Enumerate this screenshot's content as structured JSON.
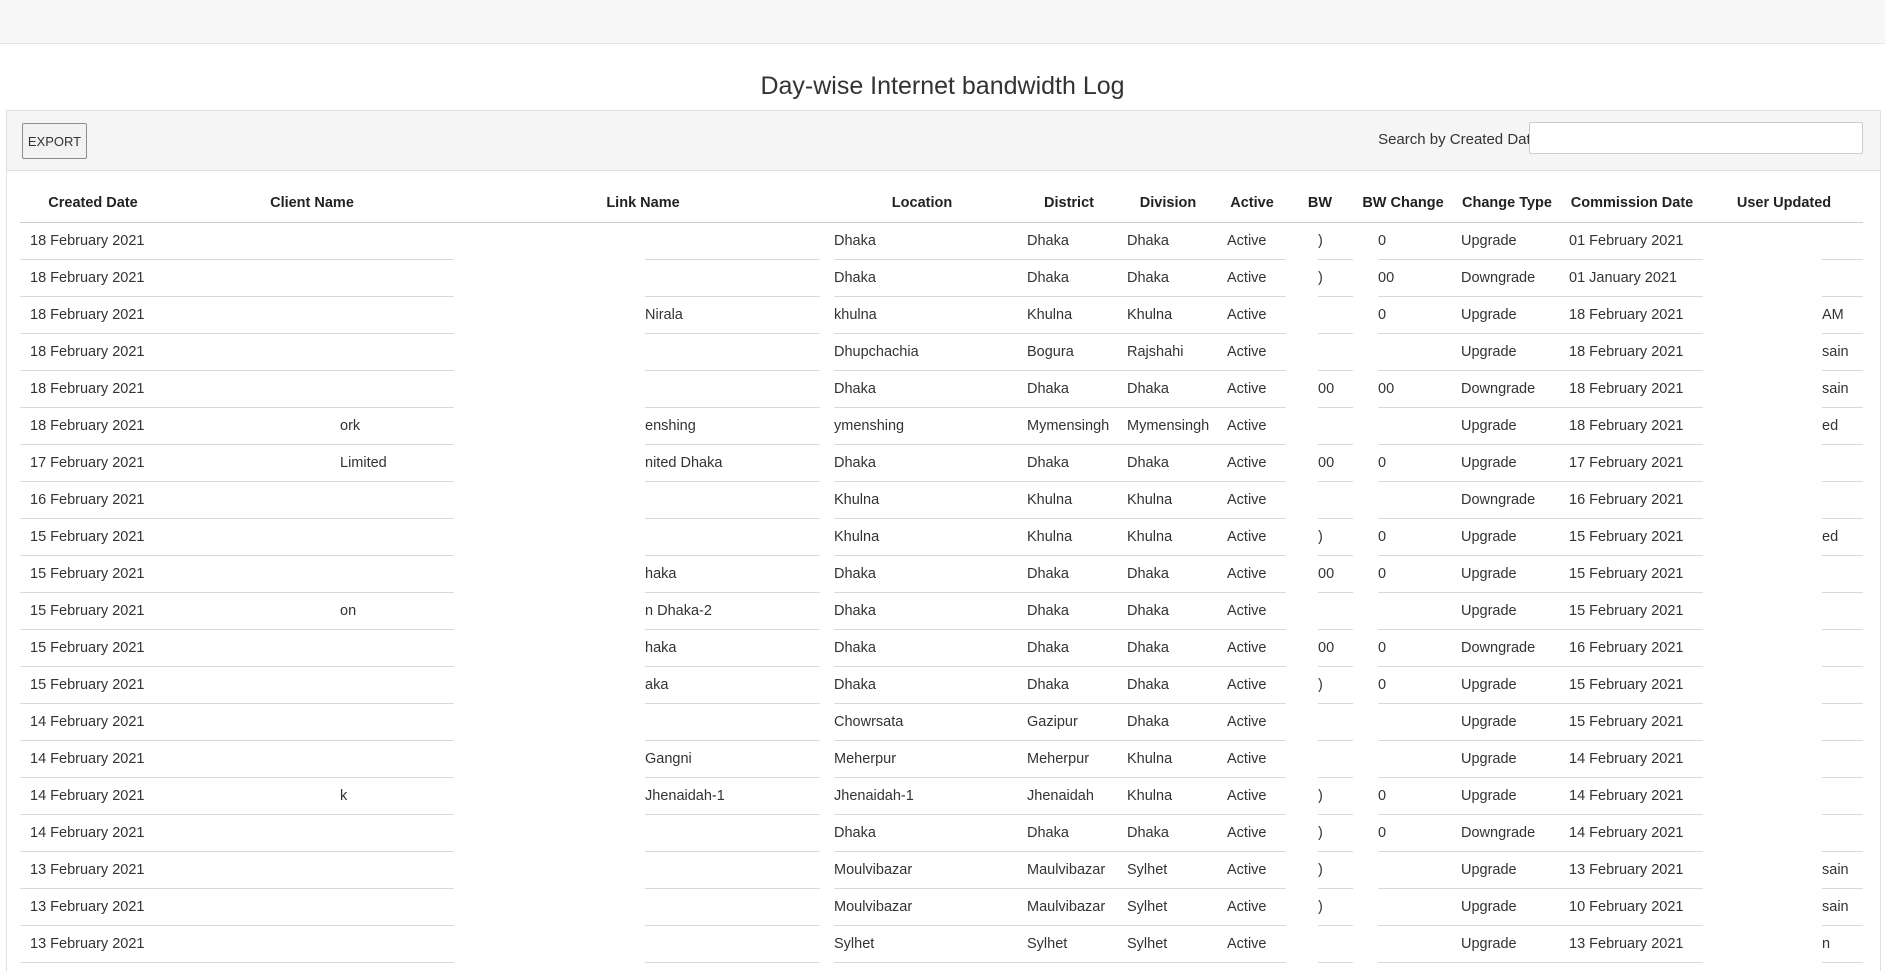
{
  "title": "Day-wise Internet bandwidth Log",
  "toolbar": {
    "export_label": "EXPORT",
    "search_label": "Search by Created Date",
    "search_value": ""
  },
  "table": {
    "columns": [
      "Created Date",
      "Client Name",
      "Link Name",
      "Location",
      "District",
      "Division",
      "Active",
      "BW",
      "BW Change",
      "Change Type",
      "Commission Date",
      "User Updated"
    ],
    "rows": [
      [
        "18 February 2021",
        "",
        "",
        "Dhaka",
        "Dhaka",
        "Dhaka",
        "Active",
        ")",
        "0",
        "Upgrade",
        "01 February 2021",
        ""
      ],
      [
        "18 February 2021",
        "",
        "",
        "Dhaka",
        "Dhaka",
        "Dhaka",
        "Active",
        ")",
        "00",
        "Downgrade",
        "01 January 2021",
        ""
      ],
      [
        "18 February 2021",
        "",
        "Nirala",
        "khulna",
        "Khulna",
        "Khulna",
        "Active",
        "",
        "0",
        "Upgrade",
        "18 February 2021",
        "AM"
      ],
      [
        "18 February 2021",
        "",
        "",
        "Dhupchachia",
        "Bogura",
        "Rajshahi",
        "Active",
        "",
        "",
        "Upgrade",
        "18 February 2021",
        "sain"
      ],
      [
        "18 February 2021",
        "",
        "",
        "Dhaka",
        "Dhaka",
        "Dhaka",
        "Active",
        "00",
        "00",
        "Downgrade",
        "18 February 2021",
        "sain"
      ],
      [
        "18 February 2021",
        "ork",
        "enshing",
        "ymenshing",
        "Mymensingh",
        "Mymensingh",
        "Active",
        "",
        "",
        "Upgrade",
        "18 February 2021",
        "ed"
      ],
      [
        "17 February 2021",
        "Limited",
        "nited Dhaka",
        "Dhaka",
        "Dhaka",
        "Dhaka",
        "Active",
        "00",
        "0",
        "Upgrade",
        "17 February 2021",
        ""
      ],
      [
        "16 February 2021",
        "",
        "",
        "Khulna",
        "Khulna",
        "Khulna",
        "Active",
        "",
        "",
        "Downgrade",
        "16 February 2021",
        ""
      ],
      [
        "15 February 2021",
        "",
        "",
        "Khulna",
        "Khulna",
        "Khulna",
        "Active",
        ")",
        "0",
        "Upgrade",
        "15 February 2021",
        "ed"
      ],
      [
        "15 February 2021",
        "",
        "haka",
        "Dhaka",
        "Dhaka",
        "Dhaka",
        "Active",
        "00",
        "0",
        "Upgrade",
        "15 February 2021",
        ""
      ],
      [
        "15 February 2021",
        "on",
        "n Dhaka-2",
        "Dhaka",
        "Dhaka",
        "Dhaka",
        "Active",
        "",
        "",
        "Upgrade",
        "15 February 2021",
        ""
      ],
      [
        "15 February 2021",
        "",
        "haka",
        "Dhaka",
        "Dhaka",
        "Dhaka",
        "Active",
        "00",
        "0",
        "Downgrade",
        "16 February 2021",
        ""
      ],
      [
        "15 February 2021",
        "",
        "aka",
        "Dhaka",
        "Dhaka",
        "Dhaka",
        "Active",
        ")",
        "0",
        "Upgrade",
        "15 February 2021",
        ""
      ],
      [
        "14 February 2021",
        "",
        "",
        "Chowrsata",
        "Gazipur",
        "Dhaka",
        "Active",
        "",
        "",
        "Upgrade",
        "15 February 2021",
        ""
      ],
      [
        "14 February 2021",
        "",
        "Gangni",
        "Meherpur",
        "Meherpur",
        "Khulna",
        "Active",
        "",
        "",
        "Upgrade",
        "14 February 2021",
        ""
      ],
      [
        "14 February 2021",
        "k",
        "Jhenaidah-1",
        "Jhenaidah-1",
        "Jhenaidah",
        "Khulna",
        "Active",
        ")",
        "0",
        "Upgrade",
        "14 February 2021",
        ""
      ],
      [
        "14 February 2021",
        "",
        "",
        "Dhaka",
        "Dhaka",
        "Dhaka",
        "Active",
        ")",
        "0",
        "Downgrade",
        "14 February 2021",
        ""
      ],
      [
        "13 February 2021",
        "",
        "",
        "Moulvibazar",
        "Maulvibazar",
        "Sylhet",
        "Active",
        ")",
        "",
        "Upgrade",
        "13 February 2021",
        "sain"
      ],
      [
        "13 February 2021",
        "",
        "",
        "Moulvibazar",
        "Maulvibazar",
        "Sylhet",
        "Active",
        ")",
        "",
        "Upgrade",
        "10 February 2021",
        "sain"
      ],
      [
        "13 February 2021",
        "",
        "",
        "Sylhet",
        "Sylhet",
        "Sylhet",
        "Active",
        "",
        "",
        "Upgrade",
        "13 February 2021",
        "n"
      ]
    ]
  }
}
